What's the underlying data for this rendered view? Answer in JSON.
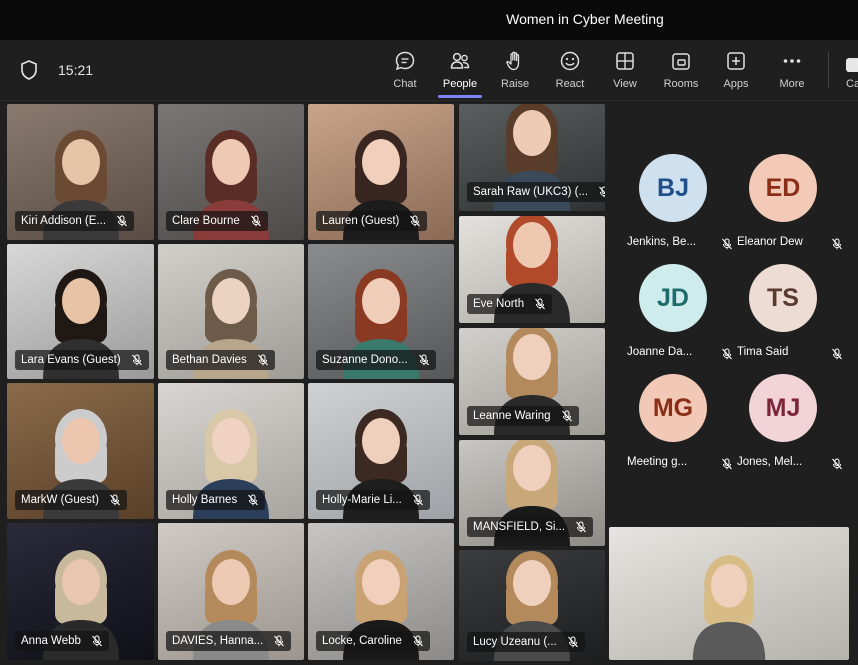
{
  "window": {
    "title": "Women in Cyber Meeting"
  },
  "toolbar": {
    "time": "15:21",
    "buttons": [
      {
        "label": "Chat",
        "icon": "chat-icon"
      },
      {
        "label": "People",
        "icon": "people-icon"
      },
      {
        "label": "Raise",
        "icon": "raise-hand-icon"
      },
      {
        "label": "React",
        "icon": "react-icon"
      },
      {
        "label": "View",
        "icon": "view-icon"
      },
      {
        "label": "Rooms",
        "icon": "rooms-icon"
      },
      {
        "label": "Apps",
        "icon": "apps-icon"
      },
      {
        "label": "More",
        "icon": "more-icon"
      },
      {
        "label": "Ca",
        "icon": "camera-icon"
      }
    ],
    "active_button": "People"
  },
  "video_tiles": [
    {
      "name": "Kiri Addison (E..."
    },
    {
      "name": "Clare Bourne"
    },
    {
      "name": "Lauren (Guest)"
    },
    {
      "name": "Lara Evans (Guest)"
    },
    {
      "name": "Bethan Davies"
    },
    {
      "name": "Suzanne Dono..."
    },
    {
      "name": "MarkW (Guest)"
    },
    {
      "name": "Holly Barnes"
    },
    {
      "name": "Holly-Marie Li..."
    },
    {
      "name": "Anna Webb"
    },
    {
      "name": "DAVIES, Hanna..."
    },
    {
      "name": "Locke, Caroline"
    },
    {
      "name": "Sarah Raw (UKC3) (..."
    },
    {
      "name": "Eve North"
    },
    {
      "name": "Leanne Waring"
    },
    {
      "name": "MANSFIELD, Si..."
    },
    {
      "name": "Lucy Uzeanu (..."
    }
  ],
  "avatars": [
    {
      "initials": "BJ",
      "name": "Jenkins, Be...",
      "bg": "#cfe0ef",
      "fg": "#1e4f8a"
    },
    {
      "initials": "ED",
      "name": "Eleanor Dew",
      "bg": "#f3c9b7",
      "fg": "#8a2e17"
    },
    {
      "initials": "JD",
      "name": "Joanne Da...",
      "bg": "#cfecec",
      "fg": "#1f6b6b"
    },
    {
      "initials": "TS",
      "name": "Tima Said",
      "bg": "#ecdcd4",
      "fg": "#5a3a2e"
    },
    {
      "initials": "MG",
      "name": "Meeting g...",
      "bg": "#f2c9b6",
      "fg": "#8a2e17"
    },
    {
      "initials": "MJ",
      "name": "Jones, Mel...",
      "bg": "#f1d3d8",
      "fg": "#7a2638"
    }
  ],
  "colors": {
    "accent": "#7f85f5",
    "titlebar": "#0a0a0a",
    "toolbar": "#1f1f1f"
  }
}
